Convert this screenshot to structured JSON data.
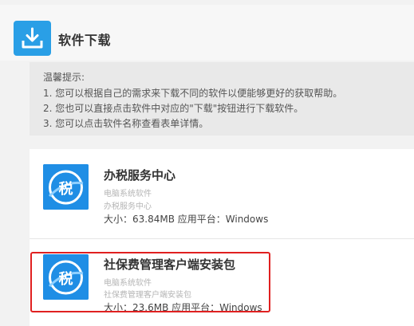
{
  "header": {
    "title": "软件下载",
    "icon": "download-icon",
    "accent": "#2a9fe6"
  },
  "tips": {
    "heading": "温馨提示:",
    "lines": [
      "1. 您可以根据自己的需求来下载不同的软件以便能够更好的获取帮助。",
      "2. 您也可以直接点击软件中对应的\"下载\"按钮进行下载软件。",
      "3. 您可以点击软件名称查看表单详情。"
    ]
  },
  "items": [
    {
      "name": "办税服务中心",
      "category": "电脑系统软件",
      "subtitle": "办税服务中心",
      "meta": "大小：63.84MB 应用平台：Windows",
      "icon_glyph": "税"
    },
    {
      "name": "社保费管理客户端安装包",
      "category": "电脑系统软件",
      "subtitle": "社保费管理客户端安装包",
      "meta": "大小：23.6MB 应用平台：Windows",
      "icon_glyph": "税"
    }
  ],
  "colors": {
    "highlight": "#e02020",
    "app_icon": "#1f8ee5"
  }
}
